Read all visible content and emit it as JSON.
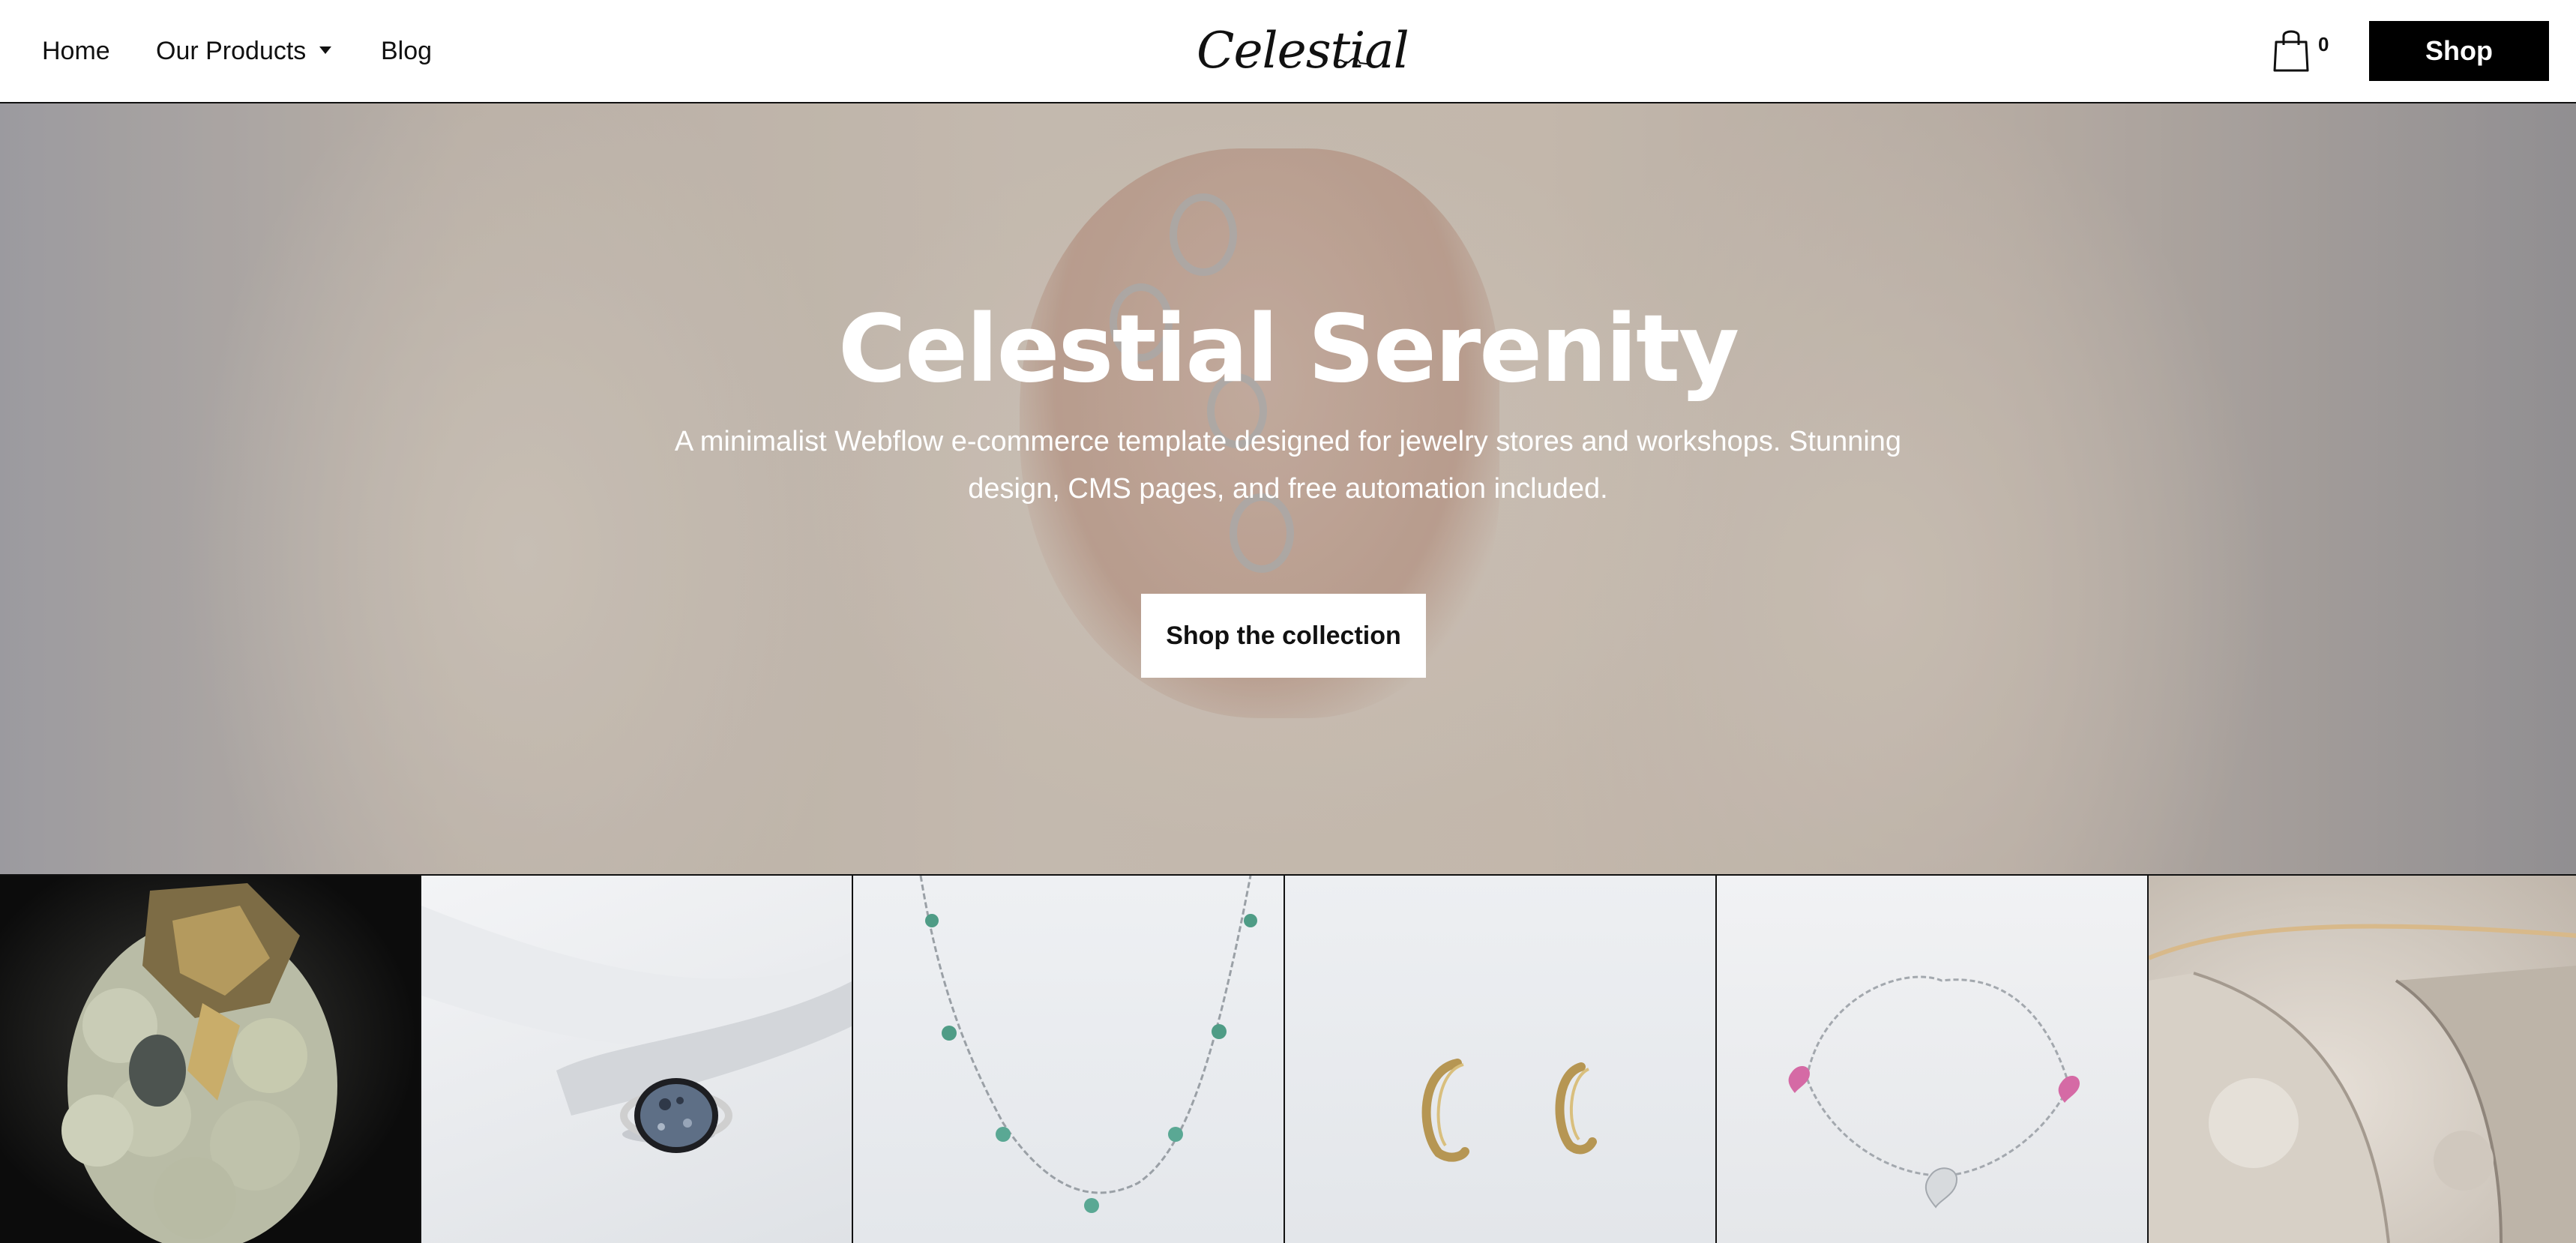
{
  "nav": {
    "home": "Home",
    "products": "Our Products",
    "blog": "Blog",
    "logo": "Celestial",
    "cart_count": "0",
    "shop": "Shop"
  },
  "hero": {
    "title": "Celestial Serenity",
    "subtitle": "A minimalist Webflow e-commerce template designed for jewelry stores and workshops. Stunning design, CMS pages, and free automation included.",
    "cta": "Shop the collection"
  },
  "products": [
    {
      "image": "pyrite-crystal"
    },
    {
      "image": "stone-ring"
    },
    {
      "image": "gem-necklace"
    },
    {
      "image": "gold-earrings"
    },
    {
      "image": "heart-bracelet"
    },
    {
      "image": "agate-slice"
    }
  ],
  "icons": {
    "cart": "shopping-bag-icon",
    "dropdown": "caret-down-icon"
  },
  "colors": {
    "primary": "#000000",
    "background": "#ffffff",
    "hero_text": "#ffffff"
  }
}
